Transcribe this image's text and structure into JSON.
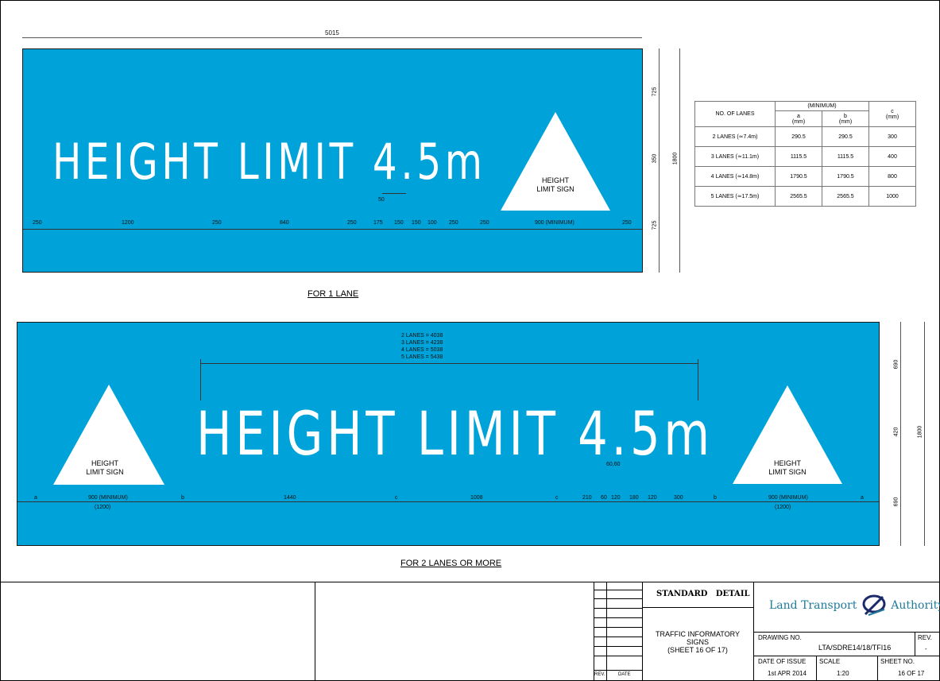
{
  "sign1": {
    "width_dim": "5015",
    "text": "HEIGHT LIMIT 4.5m",
    "triangle_label_line1": "HEIGHT",
    "triangle_label_line2": "LIMIT SIGN",
    "gap_dim": "50",
    "bottom_dims": [
      "250",
      "1200",
      "250",
      "840",
      "250",
      "175",
      "150",
      "150",
      "100",
      "250",
      "250",
      "900 (MINIMUM)",
      "250"
    ],
    "vertical_dims": [
      "725",
      "350",
      "725"
    ],
    "overall_height": "1800",
    "caption": "FOR 1 LANE"
  },
  "lanes_table": {
    "header_lanes": "NO. OF LANES",
    "header_minimum": "(MINIMUM)",
    "header_a": "a",
    "header_a_unit": "(mm)",
    "header_b": "b",
    "header_b_unit": "(mm)",
    "header_c": "c",
    "header_c_unit": "(mm)",
    "rows": [
      {
        "lanes": "2 LANES (≃7.4m)",
        "a": "290.5",
        "b": "290.5",
        "c": "300"
      },
      {
        "lanes": "3 LANES (≃11.1m)",
        "a": "1115.5",
        "b": "1115.5",
        "c": "400"
      },
      {
        "lanes": "4 LANES (≃14.8m)",
        "a": "1790.5",
        "b": "1790.5",
        "c": "800"
      },
      {
        "lanes": "5 LANES (≃17.5m)",
        "a": "2565.5",
        "b": "2565.5",
        "c": "1000"
      }
    ]
  },
  "sign2": {
    "lane_widths": [
      "2 LANES = 4038",
      "3 LANES = 4238",
      "4 LANES = 5038",
      "5 LANES = 5438"
    ],
    "text": "HEIGHT LIMIT 4.5m",
    "left_triangle_line1": "HEIGHT",
    "left_triangle_line2": "LIMIT SIGN",
    "right_triangle_line1": "HEIGHT",
    "right_triangle_line2": "LIMIT SIGN",
    "gap_dim": "60,60",
    "bottom_dims": [
      "a",
      "900 (MINIMUM)",
      "b",
      "1440",
      "c",
      "1008",
      "c",
      "210",
      "60",
      "120",
      "180",
      "120",
      "300",
      "b",
      "900 (MINIMUM)",
      "a"
    ],
    "min_note_left": "(1200)",
    "min_note_right": "(1200)",
    "vertical_dims": [
      "690",
      "420",
      "690"
    ],
    "overall_height": "1800",
    "caption": "FOR 2 LANES OR MORE"
  },
  "title_block": {
    "rev_label": "REV.",
    "date_label": "DATE",
    "standard_detail": "STANDARD   DETAIL",
    "title_line1": "TRAFFIC INFORMATORY",
    "title_line2": "SIGNS",
    "title_line3": "(SHEET 16 OF 17)",
    "org_left": "Land Transport",
    "org_right": "Authority",
    "drawing_no_label": "DRAWING NO.",
    "drawing_no": "LTA/SDRE14/18/TFI16",
    "rev_header": "REV.",
    "rev_value": "-",
    "date_issue_label": "DATE OF ISSUE",
    "date_issue": "1st APR 2014",
    "scale_label": "SCALE",
    "scale": "1:20",
    "sheet_label": "SHEET NO.",
    "sheet": "16 OF 17"
  }
}
